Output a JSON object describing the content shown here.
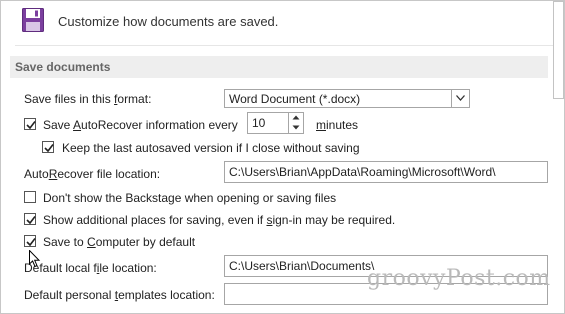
{
  "header": {
    "icon": "save-icon",
    "description": "Customize how documents are saved."
  },
  "section": {
    "title": "Save documents"
  },
  "format": {
    "label_pre": "Save files in this ",
    "label_ul": "f",
    "label_post": "ormat:",
    "selected": "Word Document (*.docx)"
  },
  "autorecover": {
    "label_pre": "Save ",
    "label_ul": "A",
    "label_post": "utoRecover information every",
    "checked": true,
    "interval": "10",
    "unit_ul": "m",
    "unit_post": "inutes"
  },
  "keep_last": {
    "label": "Keep the last autosaved version if I close without saving",
    "checked": true
  },
  "autorecover_location": {
    "label_pre": "Auto",
    "label_ul": "R",
    "label_post": "ecover file location:",
    "value": "C:\\Users\\Brian\\AppData\\Roaming\\Microsoft\\Word\\"
  },
  "backstage": {
    "label": "Don't show the Backstage when opening or saving files",
    "checked": false
  },
  "additional_places": {
    "label_pre": "Show additional places for saving, even if ",
    "label_ul": "s",
    "label_post": "ign-in may be required.",
    "checked": true
  },
  "save_to_computer": {
    "label_pre": "Save to ",
    "label_ul": "C",
    "label_post": "omputer by default",
    "checked": true
  },
  "default_local": {
    "label_pre": "Default local f",
    "label_ul": "i",
    "label_post": "le location:",
    "value": "C:\\Users\\Brian\\Documents\\"
  },
  "personal_templates": {
    "label_pre": "Default personal ",
    "label_ul": "t",
    "label_post": "emplates location:",
    "value": ""
  },
  "watermark": "groovyPost.com"
}
